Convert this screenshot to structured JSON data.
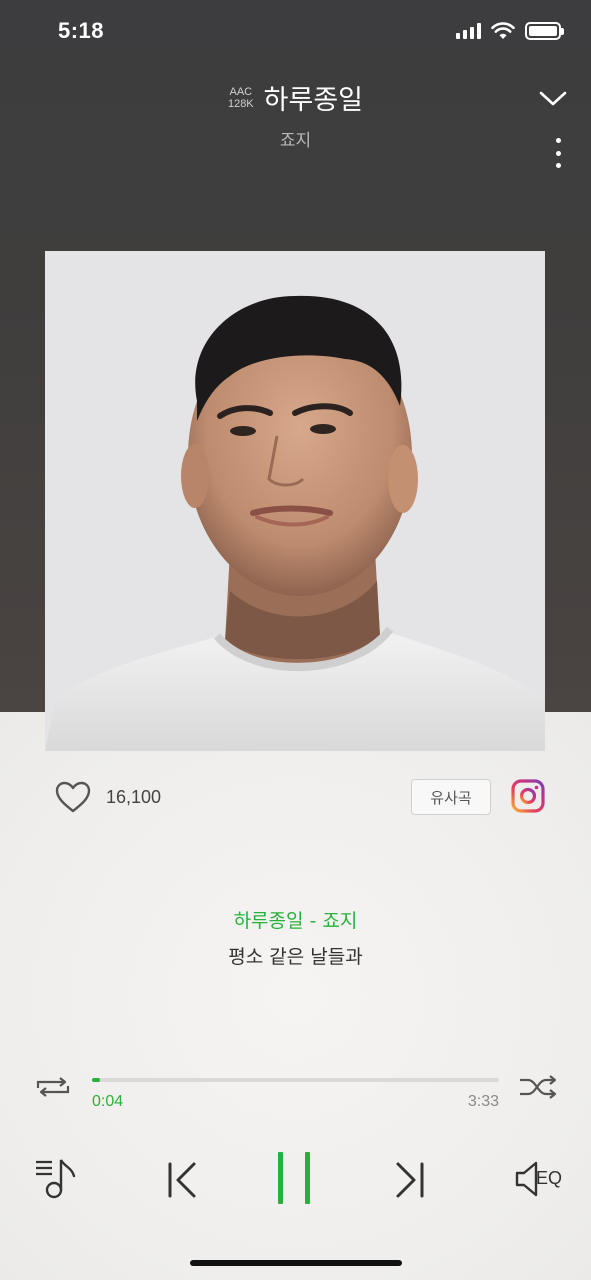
{
  "status_bar": {
    "time": "5:18"
  },
  "header": {
    "codec_top": "AAC",
    "codec_bottom": "128K",
    "title": "하루종일",
    "artist": "죠지"
  },
  "actions": {
    "like_count": "16,100",
    "similar_label": "유사곡"
  },
  "lyrics": {
    "title_line": "하루종일 - 죠지",
    "current_line": "평소 같은 날들과"
  },
  "playback": {
    "elapsed": "0:04",
    "duration": "3:33",
    "progress_fraction": 0.02
  },
  "controls": {
    "eq_label": "EQ"
  },
  "colors": {
    "accent": "#28b13a",
    "header_bg": "#3d3d3f"
  }
}
